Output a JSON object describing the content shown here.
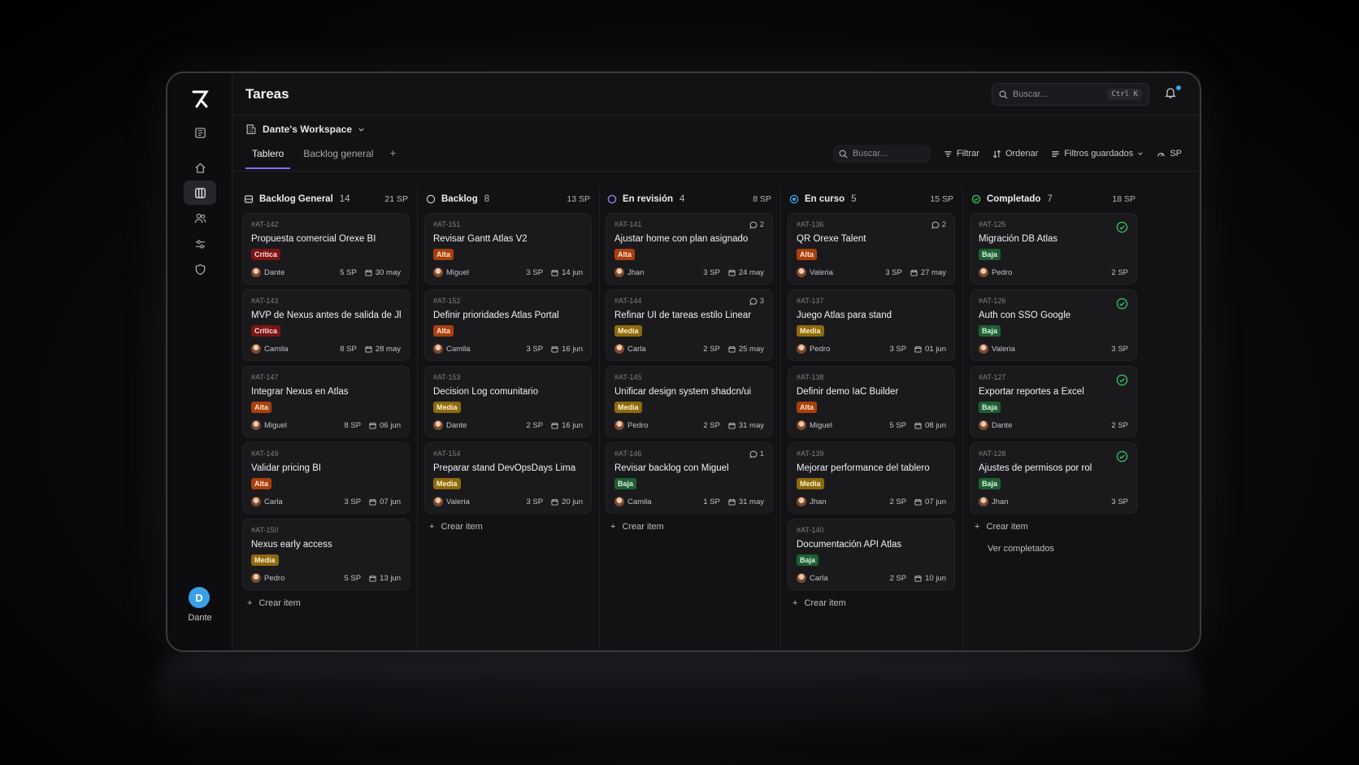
{
  "app": {
    "page_title": "Tareas",
    "user_initial": "D",
    "user_name": "Dante",
    "search_placeholder": "Buscar...",
    "search_shortcut": "Ctrl K"
  },
  "workspace": {
    "name": "Dante's Workspace"
  },
  "tabs": [
    {
      "label": "Tablero",
      "active": true
    },
    {
      "label": "Backlog general",
      "active": false
    }
  ],
  "toolbar": {
    "search_placeholder": "Buscar...",
    "filter": "Filtrar",
    "sort": "Ordenar",
    "saved_filters": "Filtros guardados",
    "sp": "SP"
  },
  "labels": {
    "create_item": "Crear item",
    "see_completed": "Ver completados"
  },
  "colors": {
    "accent": "#8a6cf0",
    "critica": "#7a1414",
    "alta": "#a8400e",
    "media": "#8d6a0f",
    "baja": "#1f5e33",
    "done": "#34c46a",
    "progress": "#3aa1e8"
  },
  "columns": [
    {
      "name": "Backlog General",
      "count": "14",
      "sp": "21 SP",
      "icon": "stack-icon",
      "cards": [
        {
          "id": "#AT-142",
          "title": "Propuesta comercial Orexe BI",
          "priority": "Crítica",
          "level": "critica",
          "user": "Dante",
          "sp": "5 SP",
          "date": "30 may"
        },
        {
          "id": "#AT-143",
          "title": "MVP de Nexus antes de salida de Jhan",
          "priority": "Crítica",
          "level": "critica",
          "user": "Camila",
          "sp": "8 SP",
          "date": "28 may"
        },
        {
          "id": "#AT-147",
          "title": "Integrar Nexus en Atlas",
          "priority": "Alta",
          "level": "alta",
          "user": "Miguel",
          "sp": "8 SP",
          "date": "06 jun"
        },
        {
          "id": "#AT-149",
          "title": "Validar pricing BI",
          "priority": "Alta",
          "level": "alta",
          "user": "Carla",
          "sp": "3 SP",
          "date": "07 jun"
        },
        {
          "id": "#AT-150",
          "title": "Nexus early access",
          "priority": "Media",
          "level": "media",
          "user": "Pedro",
          "sp": "5 SP",
          "date": "13 jun"
        }
      ]
    },
    {
      "name": "Backlog",
      "count": "8",
      "sp": "13 SP",
      "icon": "circle-empty-icon",
      "cards": [
        {
          "id": "#AT-151",
          "title": "Revisar Gantt Atlas V2",
          "priority": "Alta",
          "level": "alta",
          "user": "Miguel",
          "sp": "3 SP",
          "date": "14 jun"
        },
        {
          "id": "#AT-152",
          "title": "Definir prioridades Atlas Portal",
          "priority": "Alta",
          "level": "alta",
          "user": "Camila",
          "sp": "3 SP",
          "date": "16 jun"
        },
        {
          "id": "#AT-153",
          "title": "Decision Log comunitario",
          "priority": "Media",
          "level": "media",
          "user": "Dante",
          "sp": "2 SP",
          "date": "16 jun"
        },
        {
          "id": "#AT-154",
          "title": "Preparar stand DevOpsDays Lima",
          "priority": "Media",
          "level": "media",
          "user": "Valeria",
          "sp": "3 SP",
          "date": "20 jun"
        }
      ]
    },
    {
      "name": "En revisión",
      "count": "4",
      "sp": "8 SP",
      "icon": "circle-review-icon",
      "cards": [
        {
          "id": "#AT-141",
          "title": "Ajustar home con plan asignado",
          "priority": "Alta",
          "level": "alta",
          "user": "Jhan",
          "sp": "3 SP",
          "date": "24 may",
          "comments": "2"
        },
        {
          "id": "#AT-144",
          "title": "Refinar UI de tareas estilo Linear",
          "priority": "Media",
          "level": "media",
          "user": "Carla",
          "sp": "2 SP",
          "date": "25 may",
          "comments": "3"
        },
        {
          "id": "#AT-145",
          "title": "Unificar design system shadcn/ui",
          "priority": "Media",
          "level": "media",
          "user": "Pedro",
          "sp": "2 SP",
          "date": "31 may"
        },
        {
          "id": "#AT-146",
          "title": "Revisar backlog con Miguel",
          "priority": "Baja",
          "level": "baja",
          "user": "Camila",
          "sp": "1 SP",
          "date": "31 may",
          "comments": "1"
        }
      ]
    },
    {
      "name": "En curso",
      "count": "5",
      "sp": "15 SP",
      "icon": "circle-progress-icon",
      "cards": [
        {
          "id": "#AT-136",
          "title": "QR Orexe Talent",
          "priority": "Alta",
          "level": "alta",
          "user": "Valeria",
          "sp": "3 SP",
          "date": "27 may",
          "comments": "2"
        },
        {
          "id": "#AT-137",
          "title": "Juego Atlas para stand",
          "priority": "Media",
          "level": "media",
          "user": "Pedro",
          "sp": "3 SP",
          "date": "01 jun"
        },
        {
          "id": "#AT-138",
          "title": "Definir demo IaC Builder",
          "priority": "Alta",
          "level": "alta",
          "user": "Miguel",
          "sp": "5 SP",
          "date": "08 jun"
        },
        {
          "id": "#AT-139",
          "title": "Mejorar performance del tablero",
          "priority": "Media",
          "level": "media",
          "user": "Jhan",
          "sp": "2 SP",
          "date": "07 jun"
        },
        {
          "id": "#AT-140",
          "title": "Documentación API Atlas",
          "priority": "Baja",
          "level": "baja",
          "user": "Carla",
          "sp": "2 SP",
          "date": "10 jun"
        }
      ]
    },
    {
      "name": "Completado",
      "count": "7",
      "sp": "18 SP",
      "icon": "check-circle-icon",
      "cards": [
        {
          "id": "#AT-125",
          "title": "Migración DB Atlas",
          "priority": "Baja",
          "level": "baja",
          "user": "Pedro",
          "sp": "2 SP",
          "done": true
        },
        {
          "id": "#AT-126",
          "title": "Auth con SSO Google",
          "priority": "Baja",
          "level": "baja",
          "user": "Valeria",
          "sp": "3 SP",
          "done": true
        },
        {
          "id": "#AT-127",
          "title": "Exportar reportes a Excel",
          "priority": "Baja",
          "level": "baja",
          "user": "Dante",
          "sp": "2 SP",
          "done": true
        },
        {
          "id": "#AT-128",
          "title": "Ajustes de permisos por rol",
          "priority": "Baja",
          "level": "baja",
          "user": "Jhan",
          "sp": "3 SP",
          "done": true
        }
      ]
    }
  ]
}
